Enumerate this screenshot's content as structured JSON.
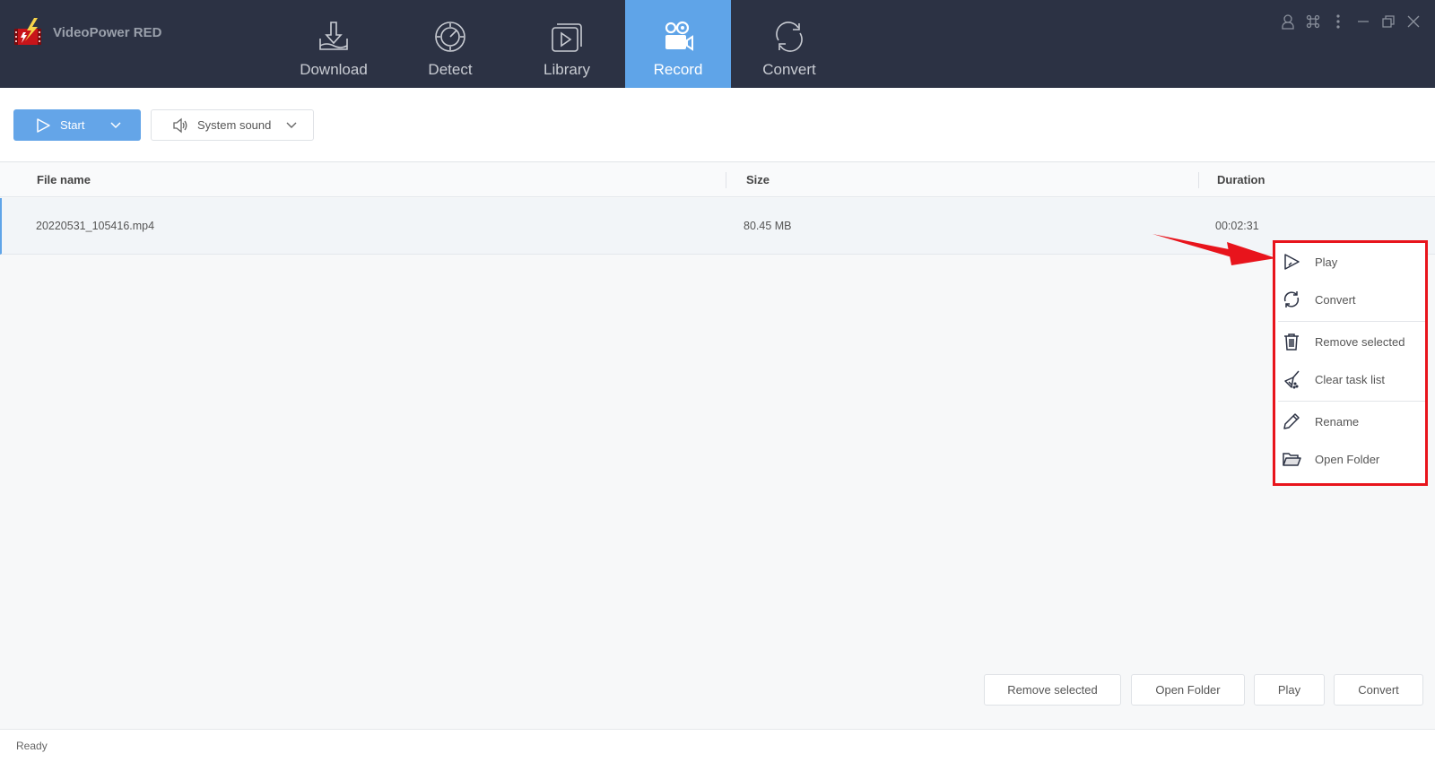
{
  "app": {
    "title": "VideoPower RED"
  },
  "nav": {
    "items": [
      {
        "label": "Download",
        "icon": "download-icon",
        "active": false
      },
      {
        "label": "Detect",
        "icon": "detect-icon",
        "active": false
      },
      {
        "label": "Library",
        "icon": "library-icon",
        "active": false
      },
      {
        "label": "Record",
        "icon": "record-icon",
        "active": true
      },
      {
        "label": "Convert",
        "icon": "convert-icon",
        "active": false
      }
    ]
  },
  "window_controls": [
    "user-icon",
    "command-icon",
    "more-icon",
    "minimize-icon",
    "restore-icon",
    "close-icon"
  ],
  "toolbar": {
    "start_label": "Start",
    "sound_label": "System sound"
  },
  "table": {
    "columns": [
      "File name",
      "Size",
      "Duration"
    ],
    "rows": [
      {
        "file_name": "20220531_105416.mp4",
        "size": "80.45 MB",
        "duration": "00:02:31",
        "selected": true
      }
    ]
  },
  "context_menu": {
    "items": [
      {
        "label": "Play",
        "icon": "play-icon"
      },
      {
        "label": "Convert",
        "icon": "convert-icon"
      },
      {
        "label": "Remove selected",
        "icon": "trash-icon"
      },
      {
        "label": "Clear task list",
        "icon": "broom-icon"
      },
      {
        "label": "Rename",
        "icon": "pencil-icon"
      },
      {
        "label": "Open Folder",
        "icon": "folder-icon"
      }
    ],
    "highlight_color": "#e8141c"
  },
  "bottom_buttons": {
    "remove_selected": "Remove selected",
    "open_folder": "Open Folder",
    "play": "Play",
    "convert": "Convert"
  },
  "status": {
    "text": "Ready"
  },
  "colors": {
    "topbar": "#2c3244",
    "accent": "#5fa4e8",
    "annotation": "#e8141c"
  }
}
